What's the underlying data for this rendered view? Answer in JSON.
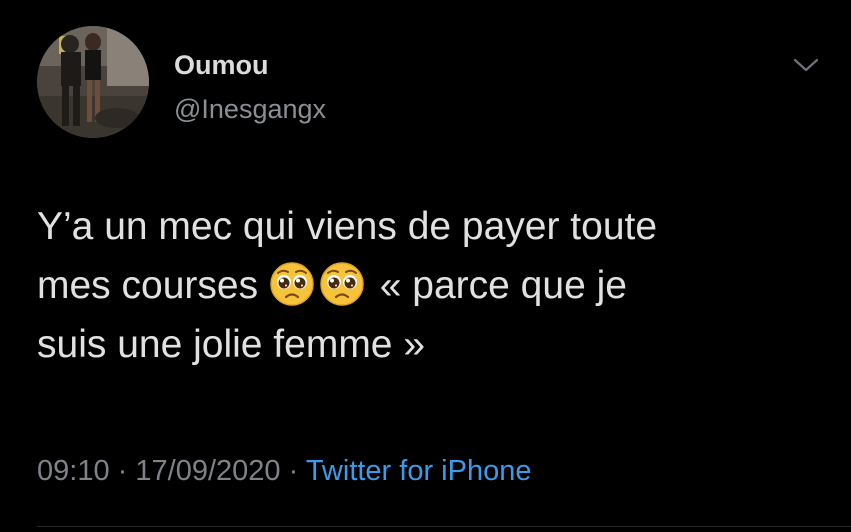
{
  "tweet": {
    "author": {
      "display_name": "Oumou",
      "handle": "@Inesgangx"
    },
    "text_lines": [
      "Y’a un mec qui viens de payer toute",
      "mes courses",
      "« parce que je",
      "suis une jolie femme »"
    ],
    "emoji": [
      "pleading-face",
      "pleading-face"
    ],
    "time": "09:10",
    "separator": "·",
    "date": "17/09/2020",
    "source": "Twitter for iPhone"
  },
  "colors": {
    "background": "#000000",
    "text": "#e1e1e1",
    "secondary_text": "#7f8389",
    "link": "#3d9ae8"
  },
  "icons": {
    "menu": "chevron-down-icon",
    "emoji": "pleading-face-emoji"
  }
}
